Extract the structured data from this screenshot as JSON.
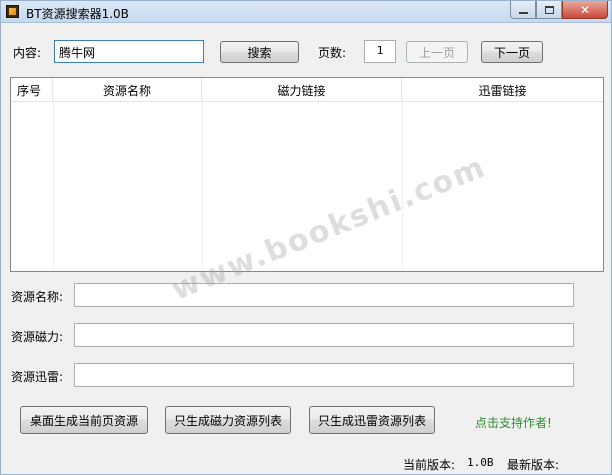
{
  "window": {
    "title": "BT资源搜索器1.0B"
  },
  "search": {
    "content_label": "内容:",
    "content_value": "腾牛网",
    "search_button": "搜索",
    "page_label": "页数:",
    "page_value": "1",
    "prev_button": "上一页",
    "next_button": "下一页"
  },
  "table": {
    "columns": [
      "序号",
      "资源名称",
      "磁力链接",
      "迅雷链接"
    ]
  },
  "details": {
    "name_label": "资源名称:",
    "magnet_label": "资源磁力:",
    "thunder_label": "资源迅雷:"
  },
  "actions": {
    "desktop_button": "桌面生成当前页资源",
    "magnet_list_button": "只生成磁力资源列表",
    "thunder_list_button": "只生成迅雷资源列表",
    "support_link": "点击支持作者!"
  },
  "status": {
    "current_version_label": "当前版本:",
    "current_version_value": "1.0B",
    "latest_version_label": "最新版本:"
  },
  "watermark": "www.bookshi.com"
}
